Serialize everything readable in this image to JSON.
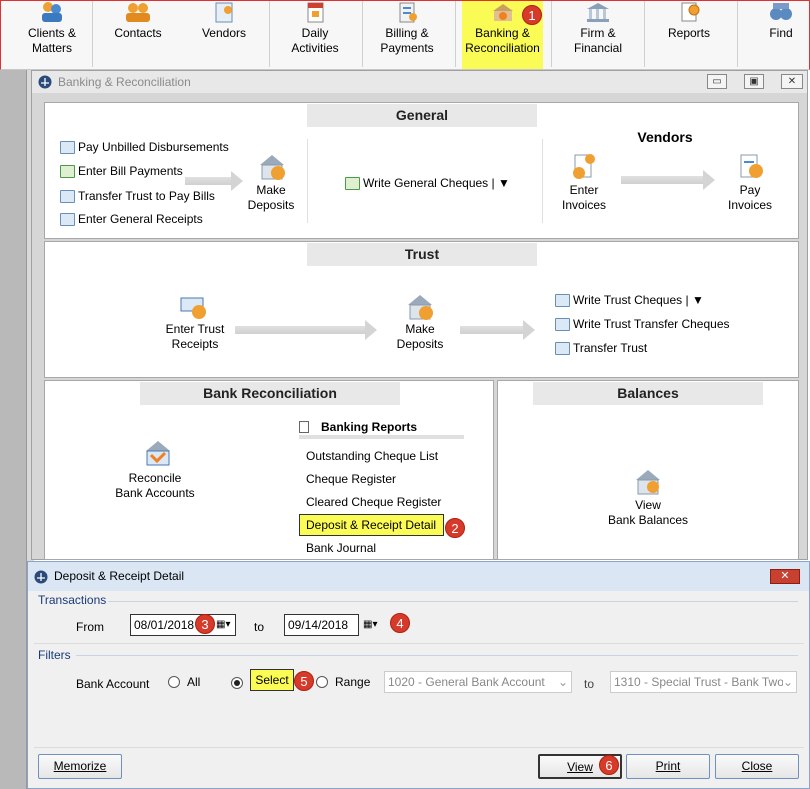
{
  "toolbar": {
    "items": [
      {
        "label": "Clients &\nMatters"
      },
      {
        "label": "Contacts"
      },
      {
        "label": "Vendors"
      },
      {
        "label": "Daily\nActivities"
      },
      {
        "label": "Billing &\nPayments"
      },
      {
        "label": "Banking &\nReconciliation"
      },
      {
        "label": "Firm &\nFinancial"
      },
      {
        "label": "Reports"
      },
      {
        "label": "Find"
      }
    ],
    "badge": "1"
  },
  "main_window": {
    "title": "Banking & Reconciliation",
    "buttons": {
      "minimize": "▭",
      "restore": "▣",
      "close": "✕"
    },
    "general": {
      "title": "General",
      "links": [
        "Pay Unbilled Disbursements",
        "Enter Bill Payments",
        "Transfer Trust to Pay Bills",
        "Enter General Receipts"
      ],
      "make_deposits": "Make\nDeposits",
      "write_general_cheques": "Write General Cheques | ▼",
      "vendors_title": "Vendors",
      "enter_invoices": "Enter\nInvoices",
      "pay_invoices": "Pay\nInvoices"
    },
    "trust": {
      "title": "Trust",
      "enter_trust_receipts": "Enter Trust\nReceipts",
      "make_deposits": "Make\nDeposits",
      "links": [
        "Write Trust Cheques | ▼",
        "Write Trust Transfer Cheques",
        "Transfer Trust"
      ]
    },
    "bank_rec": {
      "title": "Bank Reconciliation",
      "reconcile": "Reconcile\nBank Accounts",
      "reports_title": "Banking Reports",
      "reports": [
        "Outstanding Cheque List",
        "Cheque Register",
        "Cleared Cheque Register",
        "Deposit & Receipt Detail",
        "Bank Journal"
      ],
      "badge": "2"
    },
    "balances": {
      "title": "Balances",
      "view": "View\nBank Balances"
    }
  },
  "dialog": {
    "title": "Deposit & Receipt Detail",
    "transactions_label": "Transactions",
    "from_label": "From",
    "from_value": "08/01/2018",
    "to_label": "to",
    "to_value": "09/14/2018",
    "badge3": "3",
    "badge4": "4",
    "filters_label": "Filters",
    "bank_account_label": "Bank Account",
    "all_label": "All",
    "select_label": "Select",
    "badge5": "5",
    "range_label": "Range",
    "range_from": "1020 - General Bank Account",
    "range_to_label": "to",
    "range_to": "1310 - Special Trust - Bank Two",
    "memorize": "Memorize",
    "view": "View",
    "badge6": "6",
    "print": "Print",
    "close": "Close"
  }
}
